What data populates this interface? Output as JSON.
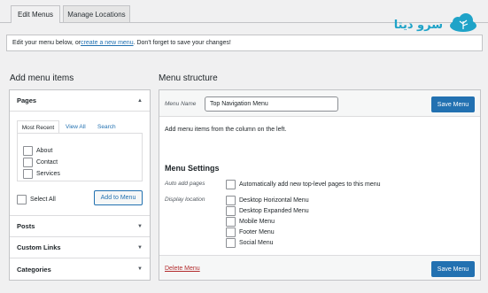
{
  "tabs": [
    {
      "label": "Edit Menus"
    },
    {
      "label": "Manage Locations"
    }
  ],
  "logo": {
    "text": "سرو دیتا",
    "accent": "#1fa3c8"
  },
  "notice": {
    "prefix": "Edit your menu below, or ",
    "link": "create a new menu",
    "suffix": ". Don't forget to save your changes!"
  },
  "left": {
    "heading": "Add menu items",
    "pages": {
      "title": "Pages",
      "tabs": [
        "Most Recent",
        "View All",
        "Search"
      ],
      "items": [
        "About",
        "Contact",
        "Services"
      ],
      "select_all": "Select All",
      "add_button": "Add to Menu"
    },
    "sections": [
      "Posts",
      "Custom Links",
      "Categories"
    ]
  },
  "right": {
    "heading": "Menu structure",
    "name_label": "Menu Name",
    "name_value": "Top Navigation Menu",
    "save": "Save Menu",
    "instruction": "Add menu items from the column on the left.",
    "settings_heading": "Menu Settings",
    "auto_label": "Auto add pages",
    "auto_option": "Automatically add new top-level pages to this menu",
    "display_label": "Display location",
    "locations": [
      "Desktop Horizontal Menu",
      "Desktop Expanded Menu",
      "Mobile Menu",
      "Footer Menu",
      "Social Menu"
    ],
    "delete": "Delete Menu"
  },
  "colors": {
    "primary": "#2271b1",
    "delete": "#b32d2e"
  }
}
